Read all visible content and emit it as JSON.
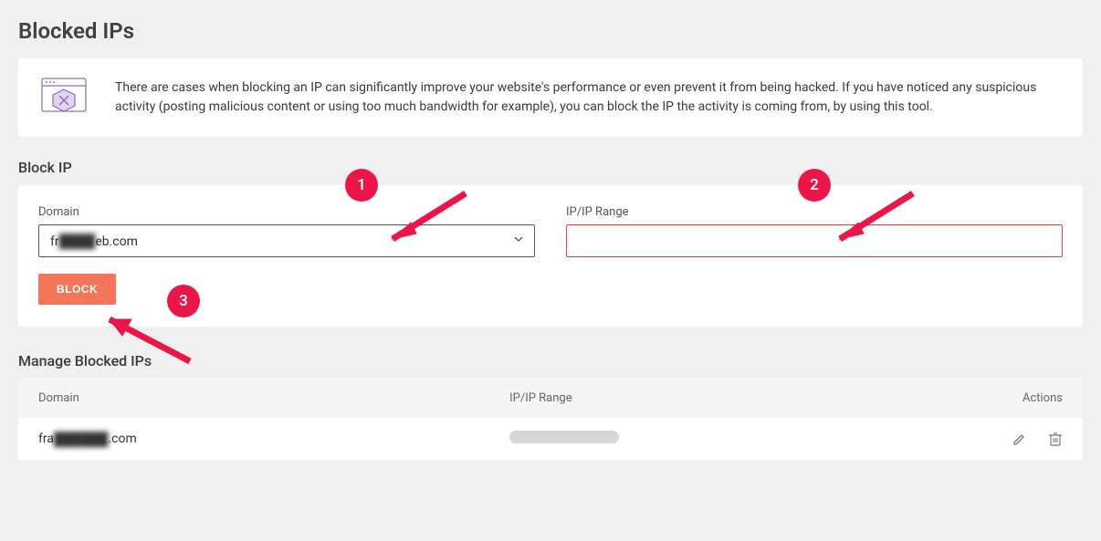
{
  "page_title": "Blocked IPs",
  "info_text": "There are cases when blocking an IP can significantly improve your website's performance or even prevent it from being hacked. If you have noticed any suspicious activity (posting malicious content or using too much bandwidth for example), you can block the IP the activity is coming from, by using this tool.",
  "block_section": {
    "heading": "Block IP",
    "domain_label": "Domain",
    "domain_value_prefix": "fr",
    "domain_value_blur": "████",
    "domain_value_suffix": "eb.com",
    "ip_label": "IP/IP Range",
    "ip_value": "",
    "button_label": "BLOCK"
  },
  "manage_section": {
    "heading": "Manage Blocked IPs",
    "columns": {
      "domain": "Domain",
      "ip": "IP/IP Range",
      "actions": "Actions"
    },
    "rows": [
      {
        "domain_prefix": "fra",
        "domain_blur": "██████",
        "domain_suffix": ".com"
      }
    ]
  },
  "annotations": {
    "b1": "1",
    "b2": "2",
    "b3": "3"
  }
}
